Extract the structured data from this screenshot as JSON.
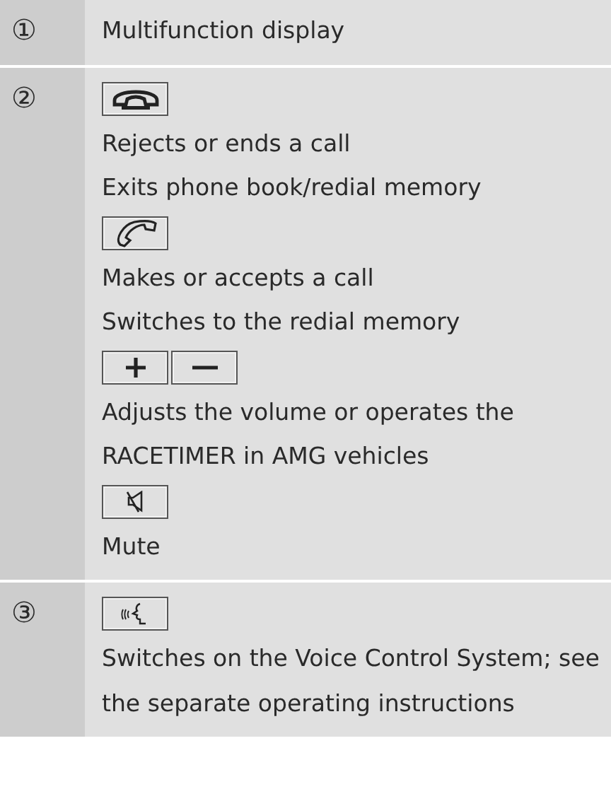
{
  "rows": [
    {
      "number": "①",
      "items": [
        {
          "kind": "text",
          "text": "Multifunction display"
        }
      ]
    },
    {
      "number": "②",
      "items": [
        {
          "kind": "end-call-key"
        },
        {
          "kind": "text",
          "text": "Rejects or ends a call"
        },
        {
          "kind": "text",
          "text": "Exits phone book/redial memory"
        },
        {
          "kind": "call-key"
        },
        {
          "kind": "text",
          "text": "Makes or accepts a call"
        },
        {
          "kind": "text",
          "text": "Switches to the redial memory"
        },
        {
          "kind": "volume-keys"
        },
        {
          "kind": "text",
          "text": "Adjusts the volume or operates the RACETIMER in AMG vehicles"
        },
        {
          "kind": "mute-key"
        },
        {
          "kind": "text",
          "text": "Mute"
        }
      ]
    },
    {
      "number": "③",
      "items": [
        {
          "kind": "voice-key"
        },
        {
          "kind": "text",
          "text": "Switches on the Voice Control System; see the separate operating instructions"
        }
      ]
    }
  ]
}
